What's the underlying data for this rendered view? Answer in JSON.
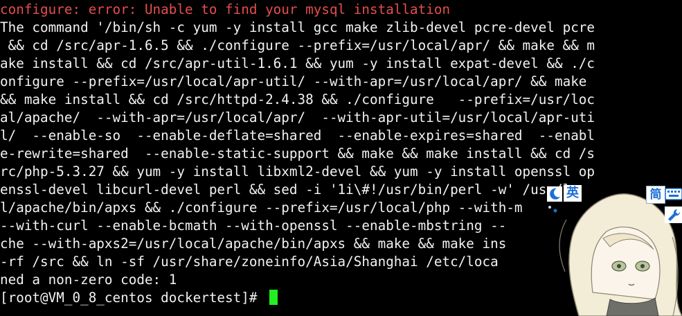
{
  "terminal": {
    "lines": [
      "configure: error: Unable to find your mysql installation",
      "The command '/bin/sh -c yum -y install gcc make zlib-devel pcre-devel pcre",
      " && cd /src/apr-1.6.5 && ./configure --prefix=/usr/local/apr/ && make && m",
      "ake install && cd /src/apr-util-1.6.1 && yum -y install expat-devel && ./c",
      "onfigure --prefix=/usr/local/apr-util/ --with-apr=/usr/local/apr/ && make",
      "&& make install && cd /src/httpd-2.4.38 && ./configure   --prefix=/usr/loc",
      "al/apache/  --with-apr=/usr/local/apr/  --with-apr-util=/usr/local/apr-uti",
      "l/  --enable-so  --enable-deflate=shared  --enable-expires=shared  --enabl",
      "e-rewrite=shared  --enable-static-support && make && make install && cd /s",
      "rc/php-5.3.27 && yum -y install libxml2-devel && yum -y install openssl op",
      "enssl-devel libcurl-devel perl && sed -i '1i\\#!/usr/bin/perl -w' /usr/lo",
      "l/apache/bin/apxs && ./configure --prefix=/usr/local/php --with-m",
      "--with-curl --enable-bcmath --with-openssl --enable-mbstring --",
      "che --with-apxs2=/usr/local/apache/bin/apxs && make && make ins",
      "-rf /src && ln -sf /usr/share/zoneinfo/Asia/Shanghai /etc/loca",
      "ned a non-zero code: 1"
    ],
    "prompt": "[root@VM_0_8_centos dockertest]# ",
    "colors": {
      "background": "#000000",
      "text": "#f2f2f2",
      "error": "#e54e4e",
      "cursor": "#22ee22"
    }
  },
  "ime_toolbar": {
    "lang_label": "英",
    "mode_icon": "moon-icon",
    "extra_icon": "dots-icon"
  },
  "side_icons": {
    "simplified_label": "简",
    "keyboard_icon": "keyboard-icon",
    "tool_icon": "wrench-icon"
  },
  "mascot": {
    "icon": "anime-girl-avatar-icon"
  }
}
